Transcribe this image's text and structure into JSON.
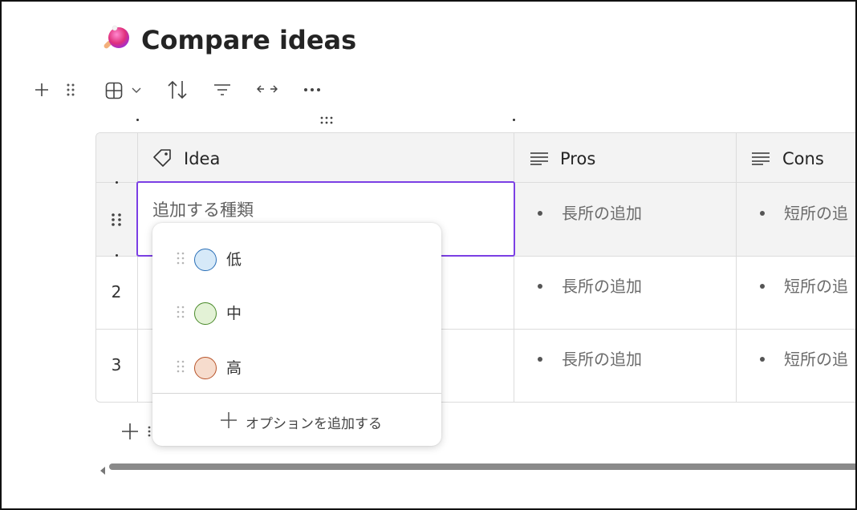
{
  "page": {
    "title": "Compare ideas",
    "title_icon": "ping-pong-paddle-icon"
  },
  "toolbar": {
    "icons": [
      "plus-icon",
      "drag-handle-icon",
      "table-view-icon",
      "chevron-down-icon",
      "sort-icon",
      "filter-icon",
      "column-width-icon",
      "more-options-icon"
    ]
  },
  "table": {
    "columns": [
      {
        "label": "Idea",
        "icon": "tag-icon"
      },
      {
        "label": "Pros",
        "icon": "text-lines-icon"
      },
      {
        "label": "Cons",
        "icon": "text-lines-icon"
      }
    ],
    "rows": [
      {
        "num": "",
        "idea": "",
        "pros": "長所の追加",
        "cons": "短所の追"
      },
      {
        "num": "2",
        "idea": "",
        "pros": "長所の追加",
        "cons": "短所の追"
      },
      {
        "num": "3",
        "idea": "",
        "pros": "長所の追加",
        "cons": "短所の追"
      }
    ],
    "editing_placeholder": "追加する種類"
  },
  "dropdown": {
    "options": [
      {
        "label": "低",
        "fill": "#d6e9f8",
        "border": "#2a6fb7"
      },
      {
        "label": "中",
        "fill": "#e3f2d6",
        "border": "#4a8a2a"
      },
      {
        "label": "高",
        "fill": "#f6dccd",
        "border": "#b8542a"
      }
    ],
    "add_option_label": "オプションを追加する"
  },
  "colors": {
    "accent": "#7b3fe4",
    "header_bg": "#f3f3f3",
    "border": "#dcdcdc"
  }
}
